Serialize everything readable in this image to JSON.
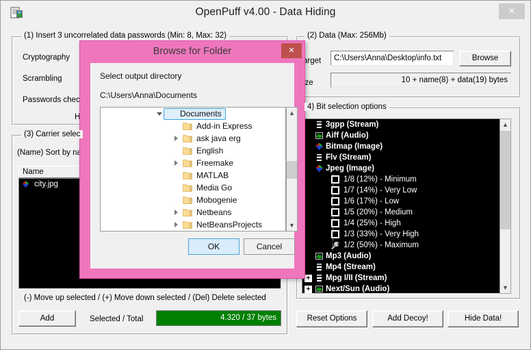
{
  "window": {
    "title": "OpenPuff v4.00 - Data Hiding",
    "icon": "document-lock-icon",
    "close_label": "✕"
  },
  "panel1": {
    "title": "(1)  Insert 3 uncorrelated data passwords (Min: 8, Max: 32)",
    "rows": [
      "Cryptography",
      "Scrambling",
      "Passwords chec",
      "H"
    ]
  },
  "panel2": {
    "title": "(2)  Data (Max: 256Mb)",
    "target_label": "arget",
    "target_value": "C:\\Users\\Anna\\Desktop\\info.txt",
    "browse_label": "Browse",
    "size_label": "ize",
    "size_value": "10 + name(8) + data(19) bytes"
  },
  "panel3": {
    "title": "(3)  Carrier selec",
    "sort_label": "(Name) Sort by na",
    "column_header": "Name",
    "rows": [
      {
        "name": "city.jpg",
        "icon": "jpeg-image-icon"
      }
    ],
    "hint": "(-) Move up selected / (+) Move down selected / (Del) Delete selected",
    "add_label": "Add",
    "selected_total_label": "Selected / Total",
    "progress_text": "4.320 / 37 bytes",
    "progress_color": "#008000"
  },
  "panel4": {
    "title": "4)  Bit selection options",
    "items": [
      {
        "label": "3gpp (Stream)",
        "kind": "format",
        "icon": "film-strip-icon",
        "expander": ""
      },
      {
        "label": "Aiff (Audio)",
        "kind": "format",
        "icon": "waveform-icon",
        "expander": ""
      },
      {
        "label": "Bitmap (Image)",
        "kind": "format",
        "icon": "rgb-image-icon",
        "expander": ""
      },
      {
        "label": "Flv (Stream)",
        "kind": "format",
        "icon": "film-strip-icon",
        "expander": ""
      },
      {
        "label": "Jpeg (Image)",
        "kind": "format",
        "icon": "rgb-image-icon",
        "expander": ""
      },
      {
        "label": "1/8 (12%) - Minimum",
        "kind": "option",
        "icon": "checkbox-unchecked-icon"
      },
      {
        "label": "1/7 (14%) - Very Low",
        "kind": "option",
        "icon": "checkbox-unchecked-icon"
      },
      {
        "label": "1/6 (17%) - Low",
        "kind": "option",
        "icon": "checkbox-unchecked-icon"
      },
      {
        "label": "1/5 (20%) - Medium",
        "kind": "option",
        "icon": "checkbox-unchecked-icon"
      },
      {
        "label": "1/4 (25%) - High",
        "kind": "option",
        "icon": "checkbox-unchecked-icon"
      },
      {
        "label": "1/3 (33%) - Very High",
        "kind": "option",
        "icon": "checkbox-unchecked-icon"
      },
      {
        "label": "1/2 (50%) - Maximum",
        "kind": "option-active",
        "icon": "wrench-icon"
      },
      {
        "label": "Mp3 (Audio)",
        "kind": "format",
        "icon": "waveform-icon",
        "expander": ""
      },
      {
        "label": "Mp4 (Stream)",
        "kind": "format",
        "icon": "film-strip-icon",
        "expander": ""
      },
      {
        "label": "Mpg I/II (Stream)",
        "kind": "format",
        "icon": "film-strip-icon",
        "expander": "+"
      },
      {
        "label": "Next/Sun (Audio)",
        "kind": "format",
        "icon": "waveform-icon",
        "expander": "+"
      }
    ]
  },
  "actions": {
    "reset_label": "Reset Options",
    "decoy_label": "Add Decoy!",
    "hide_label": "Hide Data!"
  },
  "dialog": {
    "title": "Browse for Folder",
    "close_label": "✕",
    "subtitle": "Select output directory",
    "path": "C:\\Users\\Anna\\Documents",
    "accent_color": "#ef76bd",
    "close_color": "#c0504d",
    "tree": [
      {
        "label": "Documents",
        "indent": 0,
        "twisty": "open",
        "selected": true
      },
      {
        "label": "Add-in Express",
        "indent": 1,
        "twisty": "none",
        "selected": false
      },
      {
        "label": "ask java erg",
        "indent": 1,
        "twisty": "closed",
        "selected": false
      },
      {
        "label": "English",
        "indent": 1,
        "twisty": "none",
        "selected": false
      },
      {
        "label": "Freemake",
        "indent": 1,
        "twisty": "closed",
        "selected": false
      },
      {
        "label": "MATLAB",
        "indent": 1,
        "twisty": "none",
        "selected": false
      },
      {
        "label": "Media Go",
        "indent": 1,
        "twisty": "none",
        "selected": false
      },
      {
        "label": "Mobogenie",
        "indent": 1,
        "twisty": "none",
        "selected": false
      },
      {
        "label": "Netbeans",
        "indent": 1,
        "twisty": "closed",
        "selected": false
      },
      {
        "label": "NetBeansProjects",
        "indent": 1,
        "twisty": "closed",
        "selected": false
      }
    ],
    "ok_label": "OK",
    "cancel_label": "Cancel"
  }
}
